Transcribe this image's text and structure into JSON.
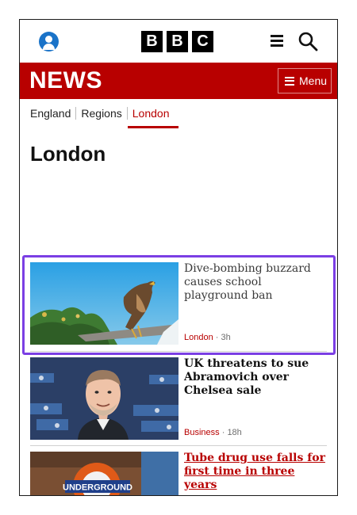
{
  "header": {
    "logo_letters": [
      "B",
      "B",
      "C"
    ],
    "news_wordmark": "NEWS",
    "menu_label": "Menu"
  },
  "breadcrumb": {
    "items": [
      {
        "label": "England"
      },
      {
        "label": "Regions"
      },
      {
        "label": "London",
        "active": true
      }
    ]
  },
  "page": {
    "title": "London"
  },
  "stories": [
    {
      "headline": "Dive-bombing buzzard causes school playground ban",
      "section": "London",
      "age": "3h"
    },
    {
      "headline": "UK threatens to sue Abramovich over Chelsea sale",
      "section": "Business",
      "age": "18h"
    },
    {
      "headline": "Tube drug use falls for first time in three years",
      "image_sign_text": "UNDERGROUND"
    }
  ],
  "colors": {
    "news_red": "#b80000",
    "highlight": "#7b3fe4",
    "account_blue": "#1a73c8"
  },
  "icons": [
    "account-icon",
    "menu-icon",
    "search-icon"
  ]
}
